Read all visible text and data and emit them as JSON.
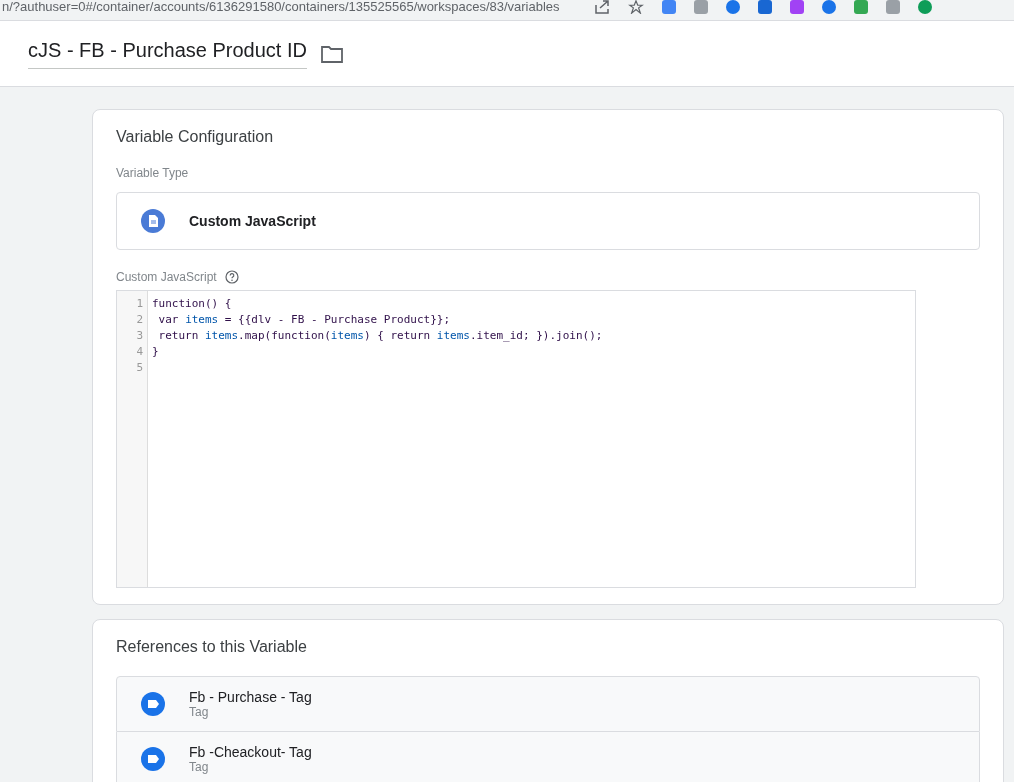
{
  "browser": {
    "address": "n/?authuser=0#/container/accounts/6136291580/containers/135525565/workspaces/83/variables"
  },
  "header": {
    "title": "cJS - FB - Purchase Product ID"
  },
  "configuration": {
    "title": "Variable Configuration",
    "type_label": "Variable Type",
    "type_name": "Custom JavaScript",
    "code_label": "Custom JavaScript",
    "code_lines": [
      {
        "number": "1",
        "segments": [
          {
            "text": "function() {",
            "kind": "plain"
          }
        ]
      },
      {
        "number": "2",
        "segments": [
          {
            "text": " var ",
            "kind": "plain"
          },
          {
            "text": "items",
            "kind": "variable"
          },
          {
            "text": " = {{dlv - FB - Purchase Product}};",
            "kind": "plain"
          }
        ]
      },
      {
        "number": "3",
        "segments": [
          {
            "text": " return ",
            "kind": "plain"
          },
          {
            "text": "items",
            "kind": "variable"
          },
          {
            "text": ".map(function(",
            "kind": "plain"
          },
          {
            "text": "items",
            "kind": "variable"
          },
          {
            "text": ") { return ",
            "kind": "plain"
          },
          {
            "text": "items",
            "kind": "variable"
          },
          {
            "text": ".item_id; }).join();",
            "kind": "plain"
          }
        ]
      },
      {
        "number": "4",
        "segments": [
          {
            "text": "}",
            "kind": "plain"
          }
        ]
      },
      {
        "number": "5"
      }
    ]
  },
  "references": {
    "title": "References to this Variable",
    "items": [
      {
        "name": "Fb - Purchase - Tag",
        "type": "Tag"
      },
      {
        "name": "Fb -Cheackout- Tag",
        "type": "Tag"
      }
    ]
  }
}
